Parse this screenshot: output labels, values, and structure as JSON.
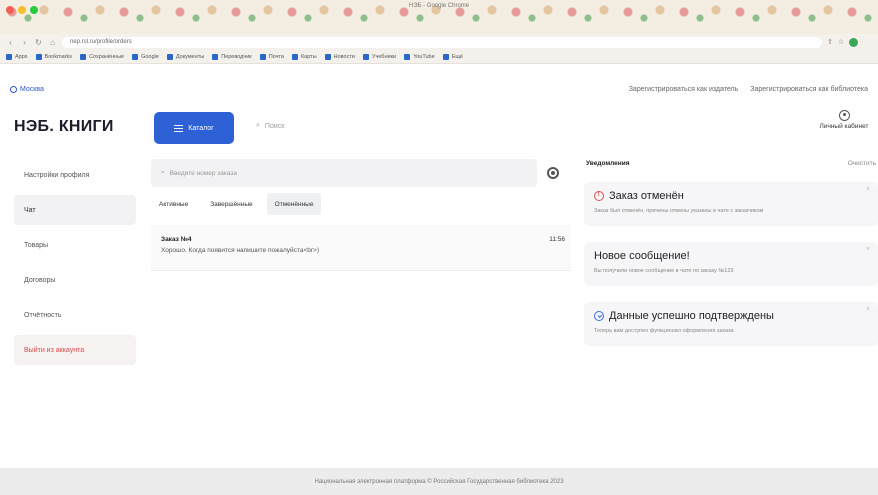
{
  "browser": {
    "window_title": "НЭБ - Google Chrome",
    "url": "nep.rsl.ru/profile/orders",
    "bookmarks": [
      "Apps",
      "Bookmarks",
      "Сохранённые",
      "Google",
      "Документы",
      "Переводчик",
      "Почта",
      "Карты",
      "Новости",
      "Учебники",
      "YouTube",
      "Ещё"
    ]
  },
  "topstrip": {
    "city": "Москва",
    "register_publisher": "Зарегистрироваться как издатель",
    "register_library": "Зарегистрироваться как библиотека"
  },
  "header": {
    "logo": "НЭБ. КНИГИ",
    "catalog_label": "Каталог",
    "search_placeholder": "Поиск",
    "account_label": "Личный кабинет"
  },
  "sidebar": {
    "items": [
      {
        "label": "Настройки профиля"
      },
      {
        "label": "Чат"
      },
      {
        "label": "Товары"
      },
      {
        "label": "Договоры"
      },
      {
        "label": "Отчётность"
      },
      {
        "label": "Выйти из аккаунта"
      }
    ]
  },
  "orders": {
    "search_placeholder": "Введите номер заказа",
    "tabs": [
      {
        "label": "Активные"
      },
      {
        "label": "Завершённые"
      },
      {
        "label": "Отменённые"
      }
    ],
    "items": [
      {
        "title": "Заказ №4",
        "message": "Хорошо. Когда появится напишите пожалуйста<br>)",
        "time": "11:56"
      }
    ]
  },
  "notifications": {
    "title": "Уведомления",
    "clear_label": "Очистить",
    "items": [
      {
        "title": "Заказ отменён",
        "text": "Заказ был отменён, причины отмены указаны в чате с заказчиком",
        "icon": "alert-circle-icon"
      },
      {
        "title": "Новое сообщение!",
        "text": "Вы получили новое сообщение в чате по заказу №123",
        "icon": ""
      },
      {
        "title": "Данные успешно подтверждены",
        "text": "Теперь вам доступен функционал оформления заказа",
        "icon": "check-circle-icon"
      }
    ]
  },
  "footer": {
    "text": "Национальная электронная платформа © Российская Государственная библиотека 2023"
  },
  "colors": {
    "accent": "#2f61d6",
    "danger": "#d94b4b"
  }
}
